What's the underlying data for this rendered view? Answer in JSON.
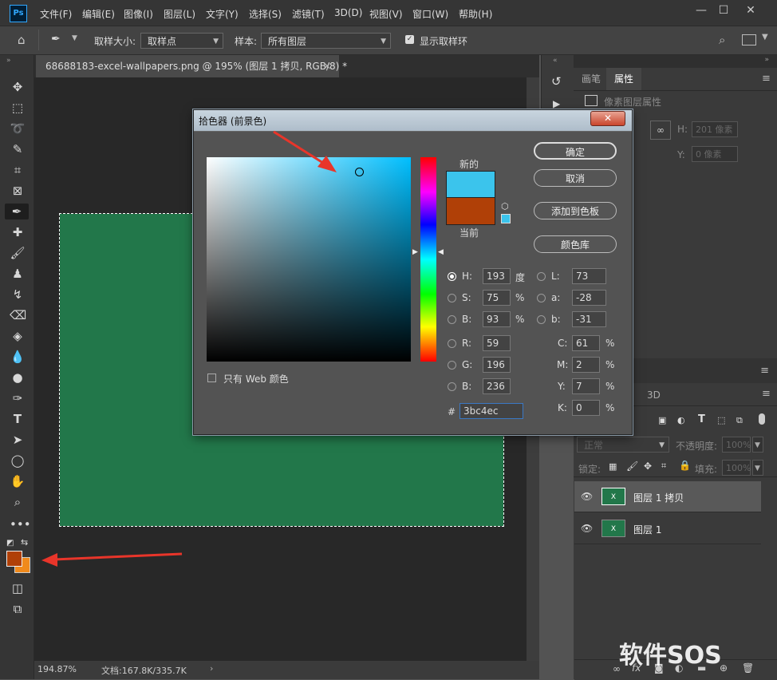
{
  "app": {
    "logo": "Ps"
  },
  "menu": [
    "文件(F)",
    "编辑(E)",
    "图像(I)",
    "图层(L)",
    "文字(Y)",
    "选择(S)",
    "滤镜(T)",
    "3D(D)",
    "视图(V)",
    "窗口(W)",
    "帮助(H)"
  ],
  "options": {
    "sample_size_label": "取样大小:",
    "sample_size_value": "取样点",
    "sample_label": "样本:",
    "sample_value": "所有图层",
    "show_ring_label": "显示取样环"
  },
  "document": {
    "tab_title": "68688183-excel-wallpapers.png @ 195% (图层 1 拷贝, RGB/8) *",
    "zoom": "194.87%",
    "doc_info": "文档:167.8K/335.7K"
  },
  "panels": {
    "tabs": [
      "画笔",
      "属性"
    ],
    "properties_title": "像素图层属性",
    "h_label": "H:",
    "h_value": "201 像素",
    "y_label": "Y:",
    "y_value": "0 像素",
    "layers_tab_3d": "3D",
    "blend_mode": "正常",
    "opacity_label": "不透明度:",
    "opacity_value": "100%",
    "lock_label": "锁定:",
    "fill_label": "填充:",
    "fill_value": "100%",
    "layers": [
      {
        "name": "图层 1 拷贝"
      },
      {
        "name": "图层 1"
      }
    ]
  },
  "picker": {
    "title": "拾色器 (前景色)",
    "new_label": "新的",
    "current_label": "当前",
    "new_color": "#3bc4ec",
    "current_color": "#b04007",
    "buttons": {
      "ok": "确定",
      "cancel": "取消",
      "add_swatch": "添加到色板",
      "libraries": "颜色库"
    },
    "web_only_label": "只有 Web 颜色",
    "hsb": {
      "h": "193",
      "s": "75",
      "b": "93",
      "h_unit": "度",
      "s_unit": "%",
      "b_unit": "%"
    },
    "rgb": {
      "r": "59",
      "g": "196",
      "b": "236"
    },
    "lab": {
      "l": "73",
      "a": "-28",
      "b": "-31"
    },
    "cmyk": {
      "c": "61",
      "m": "2",
      "y": "7",
      "k": "0",
      "unit": "%"
    },
    "hex_label": "#",
    "hex": "3bc4ec"
  },
  "labels": {
    "H": "H:",
    "S": "S:",
    "B": "B:",
    "R": "R:",
    "G": "G:",
    "Bb": "B:",
    "L": "L:",
    "a": "a:",
    "b": "b:",
    "C": "C:",
    "M": "M:",
    "Y": "Y:",
    "K": "K:"
  },
  "colors": {
    "foreground": "#b04007",
    "background": "#f08a1c",
    "layer_green": "#22774a"
  },
  "watermark": "软件SOS"
}
